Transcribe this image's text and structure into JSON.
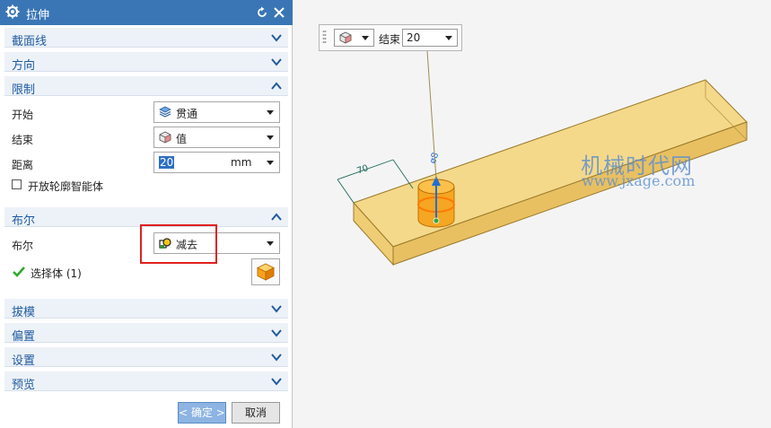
{
  "dialog": {
    "title": "拉伸",
    "sections": {
      "section_line": "截面线",
      "direction": "方向",
      "limits": "限制",
      "boolean": "布尔",
      "draft": "拔模",
      "offset": "偏置",
      "settings": "设置",
      "preview": "预览"
    },
    "limits": {
      "start_label": "开始",
      "start_value": "贯通",
      "end_label": "结束",
      "end_value": "值",
      "distance_label": "距离",
      "distance_value": "20",
      "distance_unit": "mm",
      "open_profile_label": "开放轮廓智能体"
    },
    "boolean": {
      "label": "布尔",
      "value": "减去",
      "select_body_label": "选择体 (1)"
    },
    "buttons": {
      "ok": "< 确定 >",
      "cancel": "取消"
    }
  },
  "floating_toolbar": {
    "end_label": "结束",
    "end_value": "20"
  },
  "viewport": {
    "dimension_length": "70",
    "dimension_diameter": "ø8"
  },
  "watermark": {
    "line1": "机械时代网",
    "line2": "www.jxage.com"
  },
  "colors": {
    "title_bar": "#3a76b5",
    "section_text": "#1f5aa0",
    "body_fill": "#f5d98a",
    "highlight_orange": "#f59b1b",
    "arrow_blue": "#1f6fd6",
    "annotation_red": "#e02020"
  }
}
